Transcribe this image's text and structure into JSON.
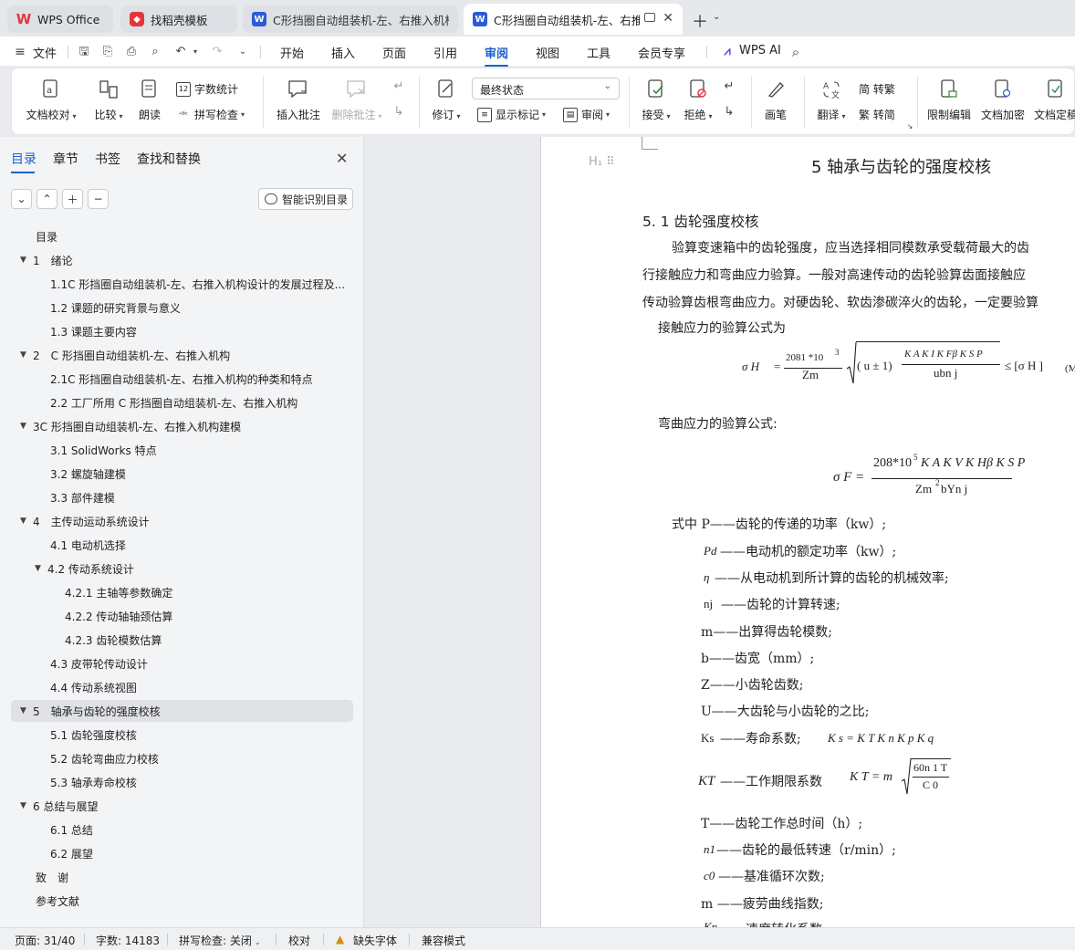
{
  "tabs": [
    {
      "label": "WPS Office",
      "icon": "wps-logo-icon"
    },
    {
      "label": "找稻壳模板",
      "icon": "docer-icon"
    },
    {
      "label": "C形挡圈自动组装机-左、右推入机构设",
      "icon": "word-doc-icon"
    },
    {
      "label": "C形挡圈自动组装机-左、右推入机构设",
      "icon": "word-doc-icon"
    }
  ],
  "menu": {
    "file": "文件",
    "items": [
      "开始",
      "插入",
      "页面",
      "引用",
      "审阅",
      "视图",
      "工具",
      "会员专享"
    ],
    "active": "审阅",
    "ai": "WPS AI"
  },
  "ribbon": {
    "doc_proof": "文档校对",
    "compare": "比较",
    "read_aloud": "朗读",
    "word_count": "字数统计",
    "spell_check": "拼写检查",
    "insert_comment": "插入批注",
    "delete_comment": "删除批注",
    "revise": "修订",
    "display_state": "最终状态",
    "show_marks": "显示标记",
    "review": "审阅",
    "accept": "接受",
    "reject": "拒绝",
    "pen": "画笔",
    "translate": "翻译",
    "simp_to_trad": "简 转繁",
    "trad_to_simp": "繁 转简",
    "restrict_edit": "限制编辑",
    "encrypt": "文档加密",
    "finalize": "文档定稿"
  },
  "nav": {
    "tabs": [
      "目录",
      "章节",
      "书签",
      "查找和替换"
    ],
    "smart_button": "智能识别目录",
    "toc": [
      {
        "label": "目录",
        "level": 0,
        "arrow": false
      },
      {
        "label": "1　绪论",
        "level": 0,
        "arrow": true
      },
      {
        "label": "1.1C 形挡圈自动组装机-左、右推入机构设计的发展过程及...",
        "level": 1,
        "arrow": false
      },
      {
        "label": "1.2 课题的研究背景与意义",
        "level": 1,
        "arrow": false
      },
      {
        "label": "1.3 课题主要内容",
        "level": 1,
        "arrow": false
      },
      {
        "label": "2　C 形挡圈自动组装机-左、右推入机构",
        "level": 0,
        "arrow": true
      },
      {
        "label": "2.1C 形挡圈自动组装机-左、右推入机构的种类和特点",
        "level": 1,
        "arrow": false
      },
      {
        "label": "2.2 工厂所用 C 形挡圈自动组装机-左、右推入机构",
        "level": 1,
        "arrow": false
      },
      {
        "label": "3C 形挡圈自动组装机-左、右推入机构建模",
        "level": 0,
        "arrow": true
      },
      {
        "label": "3.1 SolidWorks 特点",
        "level": 1,
        "arrow": false
      },
      {
        "label": "3.2 螺旋轴建模",
        "level": 1,
        "arrow": false
      },
      {
        "label": "3.3 部件建模",
        "level": 1,
        "arrow": false
      },
      {
        "label": "4　主传动运动系统设计",
        "level": 0,
        "arrow": true
      },
      {
        "label": "4.1 电动机选择",
        "level": 1,
        "arrow": false
      },
      {
        "label": "4.2 传动系统设计",
        "level": 1,
        "arrow": true
      },
      {
        "label": "4.2.1 主轴等参数确定",
        "level": 2,
        "arrow": false
      },
      {
        "label": "4.2.2 传动轴轴颈估算",
        "level": 2,
        "arrow": false
      },
      {
        "label": "4.2.3 齿轮模数估算",
        "level": 2,
        "arrow": false
      },
      {
        "label": "4.3 皮带轮传动设计",
        "level": 1,
        "arrow": false
      },
      {
        "label": "4.4 传动系统视图",
        "level": 1,
        "arrow": false
      },
      {
        "label": "5　轴承与齿轮的强度校核",
        "level": 0,
        "arrow": true
      },
      {
        "label": "5.1 齿轮强度校核",
        "level": 1,
        "arrow": false
      },
      {
        "label": "5.2 齿轮弯曲应力校核",
        "level": 1,
        "arrow": false
      },
      {
        "label": "5.3 轴承寿命校核",
        "level": 1,
        "arrow": false
      },
      {
        "label": "6 总结与展望",
        "level": 0,
        "arrow": true
      },
      {
        "label": "6.1 总结",
        "level": 1,
        "arrow": false
      },
      {
        "label": "6.2 展望",
        "level": 1,
        "arrow": false
      },
      {
        "label": "致　谢",
        "level": 0,
        "arrow": false
      },
      {
        "label": "参考文献",
        "level": 0,
        "arrow": false
      }
    ],
    "selected_index": 20
  },
  "document": {
    "chapter_title": "5  轴承与齿轮的强度校核",
    "section_title": "5. 1 齿轮强度校核",
    "para1": "验算变速箱中的齿轮强度，应当选择相同模数承受载荷最大的齿",
    "para2": "行接触应力和弯曲应力验算。一般对高速传动的齿轮验算齿面接触应",
    "para3": "传动验算齿根弯曲应力。对硬齿轮、软齿渗碳淬火的齿轮，一定要验算",
    "contact_formula_intro": "接触应力的验算公式为",
    "bending_formula_intro": "弯曲应力的验算公式:",
    "defs": [
      "式中  P——齿轮的传递的功率（kw）;",
      "——电动机的额定功率（kw）;",
      "——从电动机到所计算的齿轮的机械效率;",
      "——齿轮的计算转速;",
      "m——出算得齿轮模数;",
      "b——齿宽（mm）;",
      "Z——小齿轮齿数;",
      "U——大齿轮与小齿轮的之比;",
      "——寿命系数;",
      "——工作期限系数",
      "T——齿轮工作总时间（h）;",
      "——齿轮的最低转速（r/min）;",
      "——基准循环次数;",
      "m  ——疲劳曲线指数;",
      "——速度转化系数"
    ],
    "def_symbols": [
      "P",
      "Pd",
      "η",
      "nj",
      "Ks",
      "KT",
      "n1",
      "c0",
      "Kn"
    ],
    "formula_contact": {
      "lhs": "σ H",
      "num": "2081  *10",
      "exp": "3",
      "den": "Zm",
      "root_prefix": "( u ± 1)",
      "root_num": "K A K I  K Fβ K S P",
      "root_den": "ubn j",
      "rhs": "≤ [σ H ]",
      "tag": "(M"
    },
    "formula_bending": {
      "lhs": "σ F =",
      "num": "208*10",
      "exp": "5",
      "num_rest": "K A K V K Hβ K S P",
      "den": "Zm",
      "den_rest": "bYn j"
    },
    "formula_ks": "K s = K T K n K p K q",
    "formula_kt_lhs": "K T = m",
    "formula_kt_num": "60n 1 T",
    "formula_kt_den": "C 0"
  },
  "status": {
    "page": "页面: 31/40",
    "words": "字数: 14183",
    "spell": "拼写检查: 关闭",
    "proof": "校对",
    "missing_font": "缺失字体",
    "compat": "兼容模式"
  },
  "colors": {
    "accent": "#1f5fd1",
    "wps_red": "#e5343a",
    "word_blue": "#2b5bd7"
  }
}
